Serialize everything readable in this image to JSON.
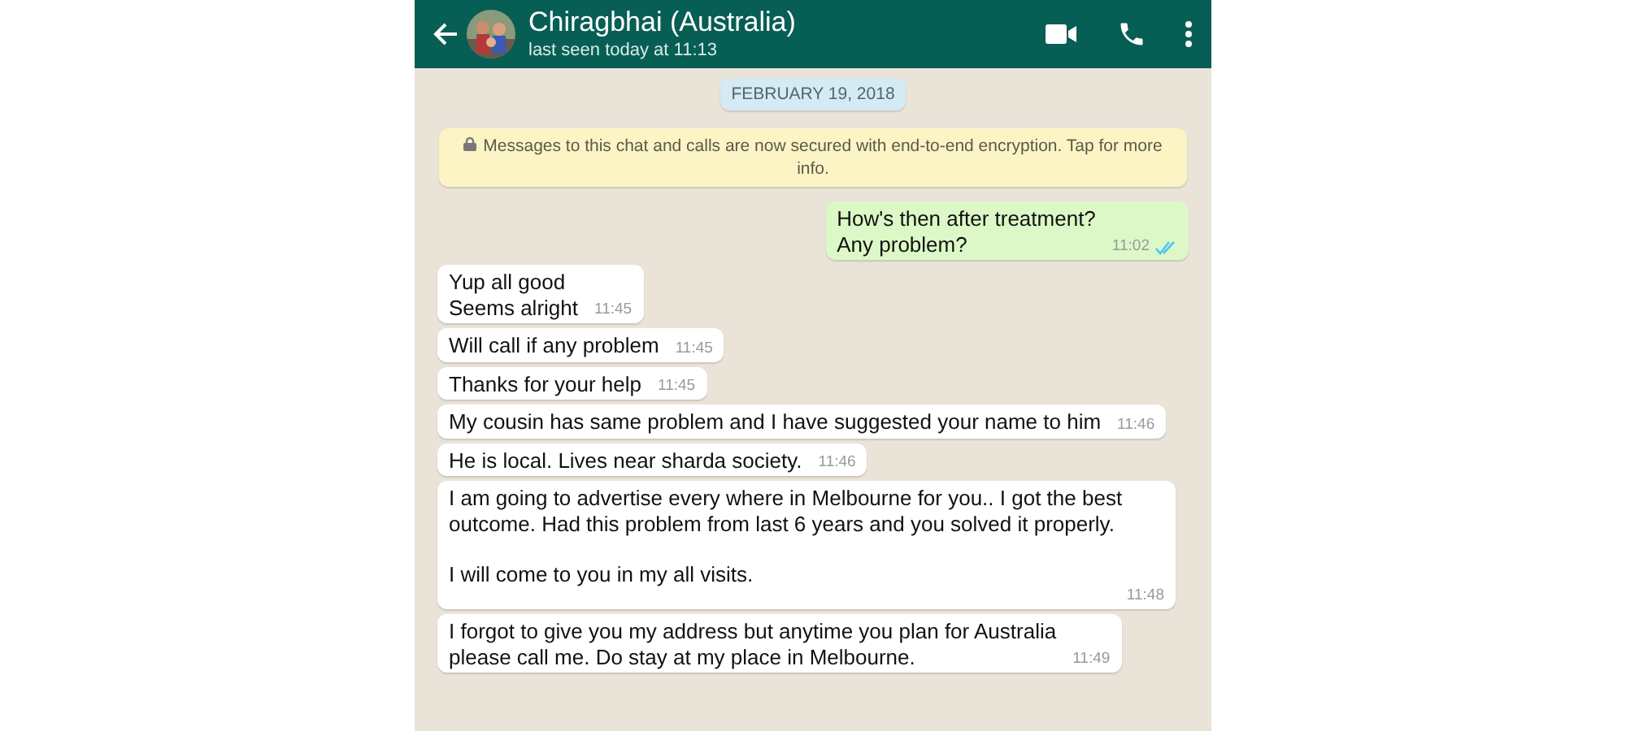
{
  "header": {
    "name": "Chiragbhai (Australia)",
    "status": "last seen today at 11:13"
  },
  "date_chip": "FEBRUARY 19, 2018",
  "notice": "Messages to this chat and calls are now secured with end-to-end encryption. Tap for more info.",
  "messages": [
    {
      "kind": "out",
      "text": "How's then after treatment?\nAny problem?",
      "time": "11:02",
      "read": true
    },
    {
      "kind": "in",
      "text": "Yup all good\nSeems alright",
      "time": "11:45"
    },
    {
      "kind": "in",
      "text": "Will call if any problem",
      "time": "11:45"
    },
    {
      "kind": "in",
      "text": "Thanks for your help",
      "time": "11:45"
    },
    {
      "kind": "in",
      "text": "My cousin has same problem and I have suggested your name to him",
      "time": "11:46"
    },
    {
      "kind": "in",
      "text": "He is local. Lives near sharda society.",
      "time": "11:46"
    },
    {
      "kind": "in",
      "text": "I am going to advertise every where in Melbourne for you.. I got the best\noutcome. Had this problem from last 6 years and you solved it properly.\n\nI will come to you in my all visits.",
      "time": "11:48"
    },
    {
      "kind": "in",
      "text": "I forgot to give you my address but anytime you plan for Australia\nplease call me. Do stay at my place in Melbourne.",
      "time": "11:49"
    }
  ]
}
